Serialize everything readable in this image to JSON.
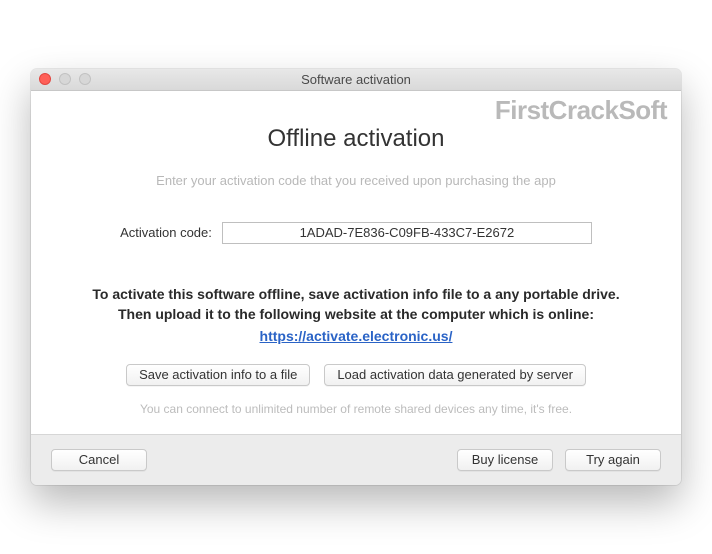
{
  "window": {
    "title": "Software activation"
  },
  "watermark": "FirstCrackSoft",
  "heading": "Offline activation",
  "subheading": "Enter your activation code that you received upon purchasing the app",
  "activation": {
    "label": "Activation code:",
    "value": "1ADAD-7E836-C09FB-433C7-E2672"
  },
  "instructions": "To activate this software offline, save activation info file to a any portable drive. Then upload it to the following website at the computer which is online:",
  "link": "https://activate.electronic.us/",
  "actions": {
    "save": "Save activation info to a file",
    "load": "Load activation data generated by server"
  },
  "footnote": "You can connect to unlimited number of remote shared devices any time, it's free.",
  "footer": {
    "cancel": "Cancel",
    "buy": "Buy license",
    "try": "Try again"
  }
}
